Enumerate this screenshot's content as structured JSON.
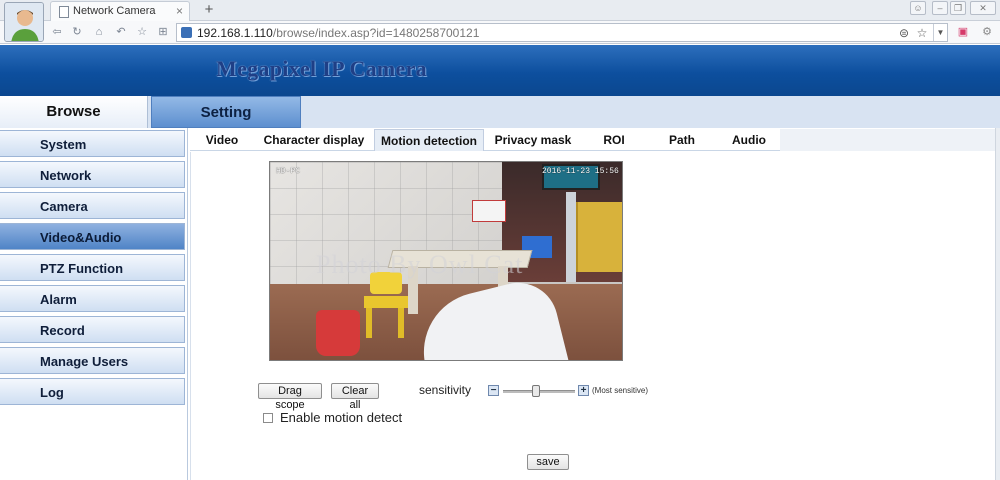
{
  "browser": {
    "tab_title": "Network Camera",
    "tab_close": "×",
    "new_tab": "+",
    "url_host": "192.168.1.110",
    "url_rest": "/browse/index.asp?id=1480258700121",
    "nav_icons": [
      "back-icon",
      "refresh-icon",
      "home-icon",
      "undo-icon",
      "star-icon",
      "grid-icon"
    ],
    "window_controls": [
      "menu-icon",
      "minimize-icon",
      "restore-icon",
      "close-icon"
    ]
  },
  "banner": {
    "title": "Megapixel IP Camera"
  },
  "main_tabs": [
    {
      "label": "Browse",
      "active": false
    },
    {
      "label": "Setting",
      "active": true
    }
  ],
  "sidebar": {
    "items": [
      {
        "label": "System"
      },
      {
        "label": "Network"
      },
      {
        "label": "Camera"
      },
      {
        "label": "Video&Audio",
        "active": true
      },
      {
        "label": "PTZ Function"
      },
      {
        "label": "Alarm"
      },
      {
        "label": "Record"
      },
      {
        "label": "Manage Users"
      },
      {
        "label": "Log"
      }
    ]
  },
  "sub_tabs": [
    {
      "label": "Video"
    },
    {
      "label": "Character display"
    },
    {
      "label": "Motion detection",
      "active": true
    },
    {
      "label": "Privacy mask"
    },
    {
      "label": "ROI"
    },
    {
      "label": "Path"
    },
    {
      "label": "Audio"
    }
  ],
  "video": {
    "osd_name": "HD-PC",
    "osd_time": "2016-11-23 15:56",
    "watermark": "Photo By Owl Cat"
  },
  "motion": {
    "drag_scope": "Drag scope",
    "clear_all": "Clear all",
    "sensitivity_label": "sensitivity",
    "minus": "−",
    "plus": "+",
    "most_sensitive": "(Most sensitive)",
    "sensitivity_level": 0.45,
    "enable_label": "Enable motion detect",
    "enable_checked": false,
    "save": "save"
  }
}
